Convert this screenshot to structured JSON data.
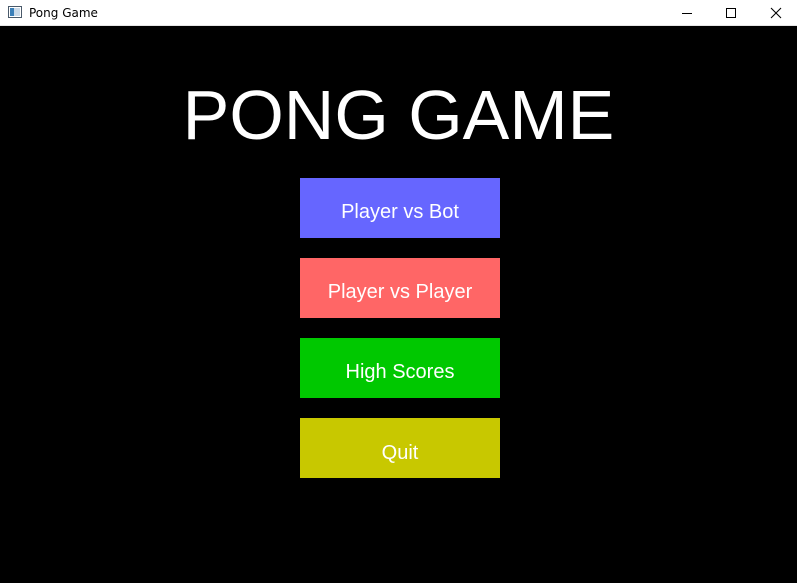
{
  "window": {
    "title": "Pong Game"
  },
  "screen": {
    "title": "PONG GAME"
  },
  "menu": {
    "buttons": [
      {
        "label": "Player vs Bot",
        "color": "#6666ff"
      },
      {
        "label": "Player vs Player",
        "color": "#ff6666"
      },
      {
        "label": "High Scores",
        "color": "#00c800"
      },
      {
        "label": "Quit",
        "color": "#c8c800"
      }
    ]
  },
  "icons": {
    "app": "app-window-icon",
    "minimize": "minimize-icon",
    "maximize": "maximize-icon",
    "close": "close-icon"
  }
}
